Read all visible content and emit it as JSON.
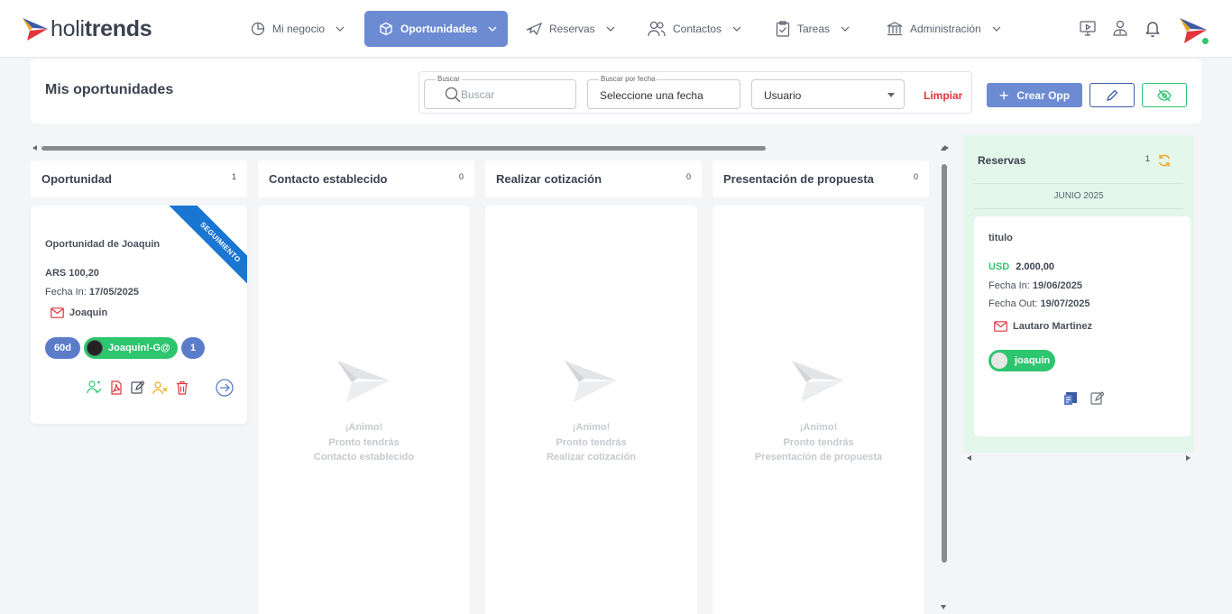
{
  "brand": {
    "light": "holi",
    "bold": "trends"
  },
  "nav": {
    "items": [
      {
        "label": "Mi negocio",
        "icon": "pie-chart-icon"
      },
      {
        "label": "Oportunidades",
        "icon": "box-icon",
        "active": true
      },
      {
        "label": "Reservas",
        "icon": "plane-icon"
      },
      {
        "label": "Contactos",
        "icon": "users-icon"
      },
      {
        "label": "Tareas",
        "icon": "clipboard-icon"
      },
      {
        "label": "Administración",
        "icon": "bank-icon"
      }
    ],
    "right_icons": [
      "screen-play-icon",
      "user-tie-icon",
      "bell-icon",
      "avatar-logo-icon"
    ]
  },
  "toolbar": {
    "title": "Mis oportunidades",
    "search": {
      "label": "Buscar",
      "placeholder": "Buscar"
    },
    "date": {
      "label": "Buscar por fecha",
      "value": "Seleccione una fecha"
    },
    "user_select": {
      "value": "Usuario"
    },
    "clear_label": "Limpiar",
    "create_label": "Crear Opp"
  },
  "columns": [
    {
      "title": "Oportunidad",
      "count": "1"
    },
    {
      "title": "Contacto establecido",
      "count": "0",
      "empty": [
        "¡Animo!",
        "Pronto tendrás",
        "Contacto establecido"
      ]
    },
    {
      "title": "Realizar cotización",
      "count": "0",
      "empty": [
        "¡Animo!",
        "Pronto tendrás",
        "Realizar cotización"
      ]
    },
    {
      "title": "Presentación de propuesta",
      "count": "0",
      "empty": [
        "¡Animo!",
        "Pronto tendrás",
        "Presentación de propuesta"
      ]
    }
  ],
  "opportunity": {
    "ribbon": "SEGUIMIENTO",
    "title": "Oportunidad de Joaquin",
    "amount": "ARS 100,20",
    "date_label": "Fecha In:",
    "date_value": "17/05/2025",
    "contact": "Joaquin",
    "days": "60d",
    "user": "Joaquin!-G@",
    "count": "1"
  },
  "reservas": {
    "title": "Reservas",
    "count": "1",
    "month": "JUNIO 2025",
    "card": {
      "title": "titulo",
      "currency": "USD",
      "amount": "2.000,00",
      "in_label": "Fecha In:",
      "in_value": "19/06/2025",
      "out_label": "Fecha Out:",
      "out_value": "19/07/2025",
      "contact": "Lautaro Martinez",
      "user": "joaquin"
    }
  },
  "colors": {
    "primary": "#6d8bd3",
    "green": "#2ec56f",
    "ribbon": "#1976d2",
    "danger": "#e0353b",
    "panel": "#e3f7ea"
  }
}
